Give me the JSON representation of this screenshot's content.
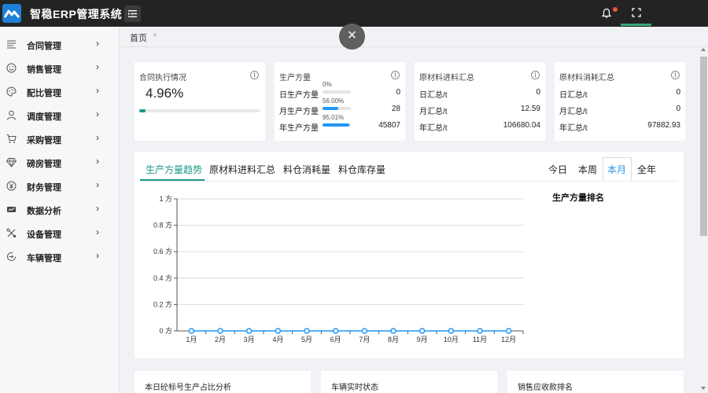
{
  "app": {
    "title": "智稳ERP管理系统"
  },
  "header": {
    "notification_icon": "bell-icon",
    "fullscreen_icon": "expand-icon"
  },
  "sidebar": {
    "items": [
      {
        "label": "合同管理",
        "icon": "document-lines-icon"
      },
      {
        "label": "销售管理",
        "icon": "smile-icon"
      },
      {
        "label": "配比管理",
        "icon": "palette-icon"
      },
      {
        "label": "调度管理",
        "icon": "user-icon"
      },
      {
        "label": "采购管理",
        "icon": "cart-icon"
      },
      {
        "label": "磅房管理",
        "icon": "diamond-icon"
      },
      {
        "label": "财务管理",
        "icon": "yen-icon"
      },
      {
        "label": "数据分析",
        "icon": "chart-icon"
      },
      {
        "label": "设备管理",
        "icon": "tools-icon"
      },
      {
        "label": "车辆管理",
        "icon": "vehicle-icon"
      }
    ]
  },
  "tabs": {
    "home": "首页"
  },
  "cards": {
    "contract": {
      "title": "合同执行情况",
      "value": "4.96%",
      "progress": 0.0496
    },
    "production": {
      "title": "生产方量",
      "rows": [
        {
          "label": "日生产方量",
          "pct": "0%",
          "fraction": 0,
          "value": "0"
        },
        {
          "label": "月生产方量",
          "pct": "56.00%",
          "fraction": 0.56,
          "value": "28"
        },
        {
          "label": "年生产方量",
          "pct": "95.01%",
          "fraction": 0.9501,
          "value": "45807"
        }
      ]
    },
    "raw_in": {
      "title": "原材料进料汇总",
      "rows": [
        {
          "label": "日汇总/t",
          "value": "0"
        },
        {
          "label": "月汇总/t",
          "value": "12.59"
        },
        {
          "label": "年汇总/t",
          "value": "106680.04"
        }
      ]
    },
    "raw_use": {
      "title": "原材料消耗汇总",
      "rows": [
        {
          "label": "日汇总/t",
          "value": "0"
        },
        {
          "label": "月汇总/t",
          "value": "0"
        },
        {
          "label": "年汇总/t",
          "value": "97882.93"
        }
      ]
    }
  },
  "chart_panel": {
    "tabs": [
      "生产方量趋势",
      "原材料进料汇总",
      "料仓消耗量",
      "料仓库存量"
    ],
    "active_tab": 0,
    "periods": [
      "今日",
      "本周",
      "本月",
      "全年"
    ],
    "active_period": 2,
    "ranking_title": "生产方量排名"
  },
  "chart_data": {
    "type": "line",
    "categories": [
      "1月",
      "2月",
      "3月",
      "4月",
      "5月",
      "6月",
      "7月",
      "8月",
      "9月",
      "10月",
      "11月",
      "12月"
    ],
    "series": [
      {
        "values": [
          0,
          0,
          0,
          0,
          0,
          0,
          0,
          0,
          0,
          0,
          0,
          0
        ]
      }
    ],
    "yticks": [
      "0 方",
      "0.2 方",
      "0.4 方",
      "0.6 方",
      "0.8 方",
      "1 方"
    ],
    "ylim": [
      0,
      1
    ],
    "grid": true,
    "color": "#2196f3"
  },
  "bottom": {
    "titles": [
      "本日砼标号生产占比分析",
      "车辆实时状态",
      "销售应收款排名"
    ]
  }
}
